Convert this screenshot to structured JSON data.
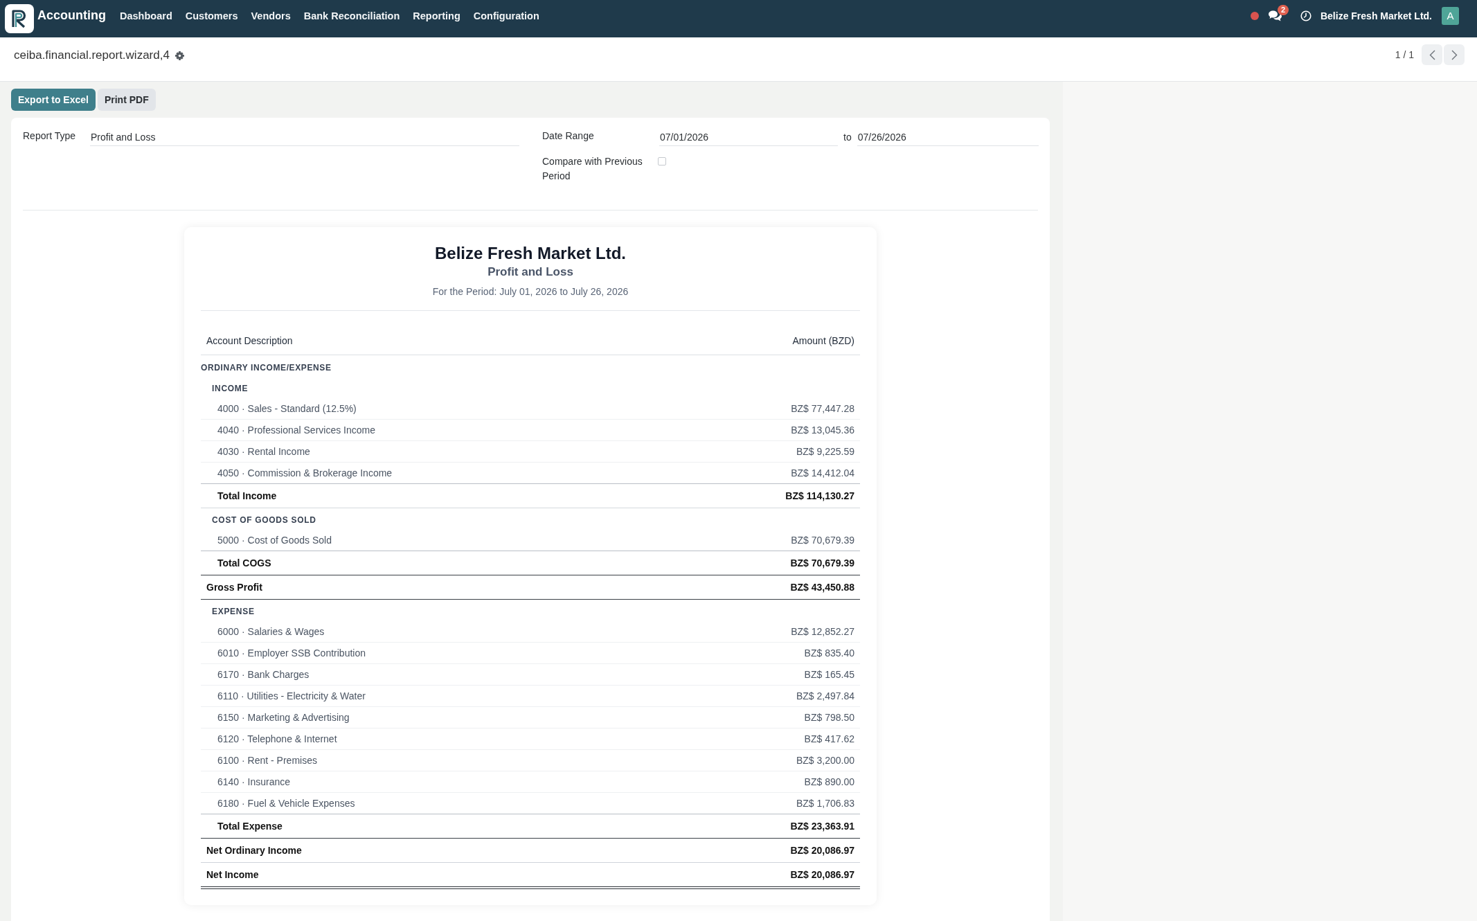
{
  "navbar": {
    "app_name": "Accounting",
    "menu": [
      "Dashboard",
      "Customers",
      "Vendors",
      "Bank Reconciliation",
      "Reporting",
      "Configuration"
    ],
    "message_count": "2",
    "company": "Belize Fresh Market Ltd.",
    "avatar_initial": "A"
  },
  "control_panel": {
    "record_title": "ceiba.financial.report.wizard,4",
    "pager": "1 / 1"
  },
  "actions": [
    {
      "label": "Export to Excel",
      "kind": "primary"
    },
    {
      "label": "Print PDF",
      "kind": "secondary"
    }
  ],
  "form": {
    "report_type": {
      "label": "Report Type",
      "value": "Profit and Loss"
    },
    "date_range": {
      "label": "Date Range",
      "start": "07/01/2026",
      "separator": "to",
      "end": "07/26/2026"
    },
    "compare": {
      "label": "Compare with Previous Period",
      "checked": false
    }
  },
  "report": {
    "company": "Belize Fresh Market Ltd.",
    "title": "Profit and Loss",
    "period": "For the Period: July 01, 2026 to July 26, 2026",
    "columns": [
      "Account Description",
      "Amount (BZD)"
    ],
    "rows": [
      {
        "kind": "section",
        "label": "ORDINARY INCOME/EXPENSE"
      },
      {
        "kind": "group",
        "label": "INCOME"
      },
      {
        "kind": "account",
        "label": "4000 · Sales - Standard (12.5%)",
        "amount": "BZ$ 77,447.28"
      },
      {
        "kind": "account",
        "label": "4040 · Professional Services Income",
        "amount": "BZ$ 13,045.36"
      },
      {
        "kind": "account",
        "label": "4030 · Rental Income",
        "amount": "BZ$ 9,225.59"
      },
      {
        "kind": "account",
        "label": "4050 · Commission & Brokerage Income",
        "amount": "BZ$ 14,412.04"
      },
      {
        "kind": "subtotal",
        "label": "Total Income",
        "amount": "BZ$ 114,130.27"
      },
      {
        "kind": "group",
        "label": "COST OF GOODS SOLD"
      },
      {
        "kind": "account",
        "label": "5000 · Cost of Goods Sold",
        "amount": "BZ$ 70,679.39"
      },
      {
        "kind": "subtotal",
        "label": "Total COGS",
        "amount": "BZ$ 70,679.39"
      },
      {
        "kind": "total",
        "label": "Gross Profit",
        "amount": "BZ$ 43,450.88"
      },
      {
        "kind": "group",
        "label": "EXPENSE"
      },
      {
        "kind": "account",
        "label": "6000 · Salaries & Wages",
        "amount": "BZ$ 12,852.27"
      },
      {
        "kind": "account",
        "label": "6010 · Employer SSB Contribution",
        "amount": "BZ$ 835.40"
      },
      {
        "kind": "account",
        "label": "6170 · Bank Charges",
        "amount": "BZ$ 165.45"
      },
      {
        "kind": "account",
        "label": "6110 · Utilities - Electricity & Water",
        "amount": "BZ$ 2,497.84"
      },
      {
        "kind": "account",
        "label": "6150 · Marketing & Advertising",
        "amount": "BZ$ 798.50"
      },
      {
        "kind": "account",
        "label": "6120 · Telephone & Internet",
        "amount": "BZ$ 417.62"
      },
      {
        "kind": "account",
        "label": "6100 · Rent - Premises",
        "amount": "BZ$ 3,200.00"
      },
      {
        "kind": "account",
        "label": "6140 · Insurance",
        "amount": "BZ$ 890.00"
      },
      {
        "kind": "account",
        "label": "6180 · Fuel & Vehicle Expenses",
        "amount": "BZ$ 1,706.83"
      },
      {
        "kind": "subtotal",
        "label": "Total Expense",
        "amount": "BZ$ 23,363.91"
      },
      {
        "kind": "total",
        "label": "Net Ordinary Income",
        "amount": "BZ$ 20,086.97"
      },
      {
        "kind": "final",
        "label": "Net Income",
        "amount": "BZ$ 20,086.97"
      }
    ]
  }
}
